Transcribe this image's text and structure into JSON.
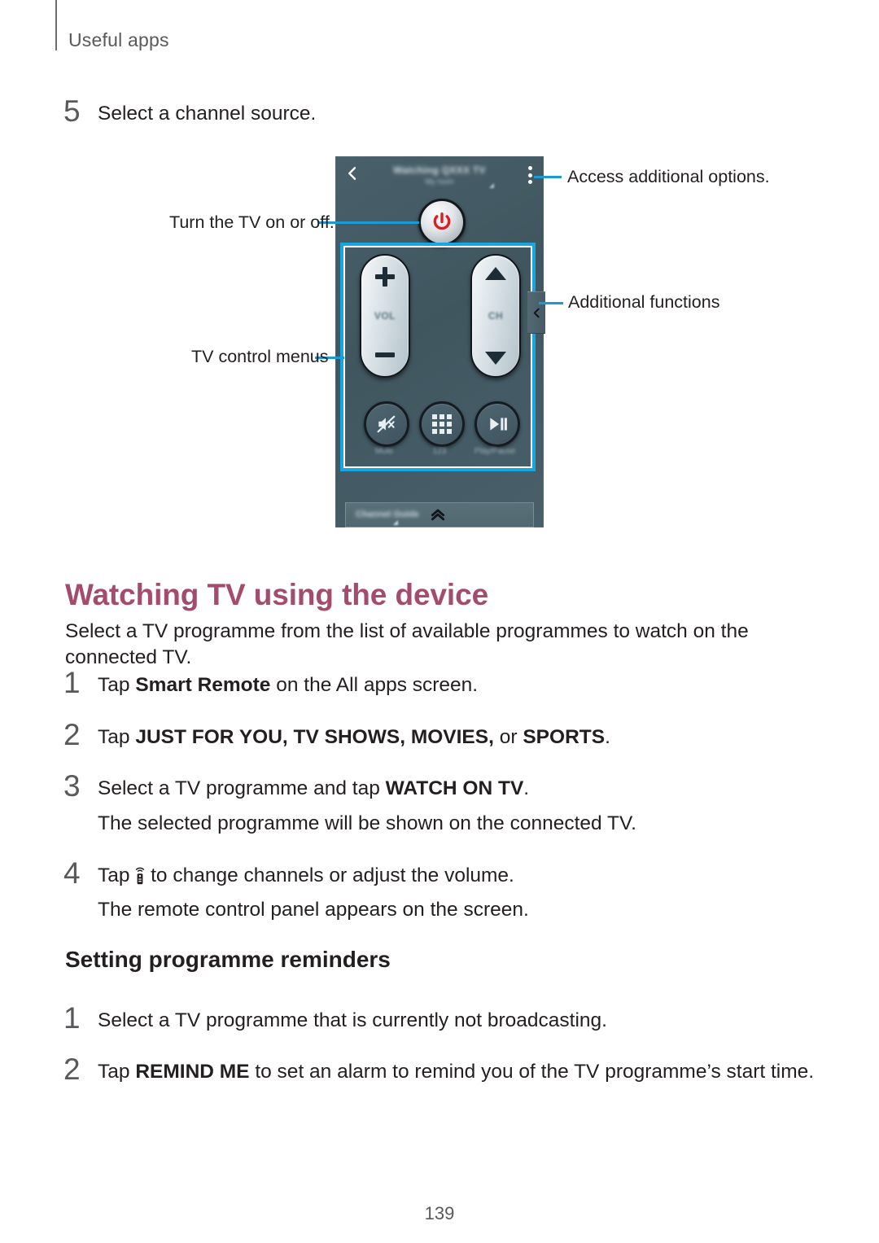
{
  "header": {
    "running_head": "Useful apps"
  },
  "step5": {
    "number": "5",
    "text": "Select a channel source."
  },
  "figure": {
    "callouts": [
      {
        "id": "access-options",
        "label": "Access additional options."
      },
      {
        "id": "power",
        "label": "Turn the TV on or off."
      },
      {
        "id": "additional-functions",
        "label": "Additional functions"
      },
      {
        "id": "tv-control-menus",
        "label": "TV control menus"
      }
    ],
    "phone": {
      "title": "Watching QXXX TV",
      "subtitle": "My room",
      "back_icon": "chevron-left-icon",
      "more_icon": "overflow-menu-icon",
      "power_icon": "power-icon",
      "volume_label": "VOL",
      "channel_label": "CH",
      "buttons": [
        {
          "icon": "mute-icon",
          "label": "Mute"
        },
        {
          "icon": "keypad-icon",
          "label": "123"
        },
        {
          "icon": "play-pause-icon",
          "label": "Play/Pause"
        }
      ],
      "guide_label": "Channel Guide",
      "guide_icon": "chevron-double-up-icon",
      "side_tab_icon": "chevron-left-icon"
    },
    "accent_color": "#16a7e0"
  },
  "section1": {
    "heading": "Watching TV using the device",
    "heading_color": "#a34c6b",
    "intro": "Select a TV programme from the list of available programmes to watch on the connected TV.",
    "steps": [
      {
        "number": "1",
        "prefix": "Tap ",
        "bold": "Smart Remote",
        "suffix": " on the All apps screen."
      },
      {
        "number": "2",
        "prefix": "Tap ",
        "bold": "JUST FOR YOU, TV SHOWS, MOVIES,",
        "suffix": " or ",
        "bold2": "SPORTS",
        "suffix2": "."
      },
      {
        "number": "3",
        "prefix": "Select a TV programme and tap ",
        "bold": "WATCH ON TV",
        "suffix": ".",
        "note": "The selected programme will be shown on the connected TV."
      },
      {
        "number": "4",
        "prefix": "Tap ",
        "icon": "remote-control-icon",
        "suffix": " to change channels or adjust the volume.",
        "note": "The remote control panel appears on the screen."
      }
    ]
  },
  "section2": {
    "heading": "Setting programme reminders",
    "steps": [
      {
        "number": "1",
        "prefix": "Select a TV programme that is currently not broadcasting."
      },
      {
        "number": "2",
        "prefix": "Tap ",
        "bold": "REMIND ME",
        "suffix": " to set an alarm to remind you of the TV programme’s start time."
      }
    ]
  },
  "footer": {
    "page_number": "139"
  }
}
